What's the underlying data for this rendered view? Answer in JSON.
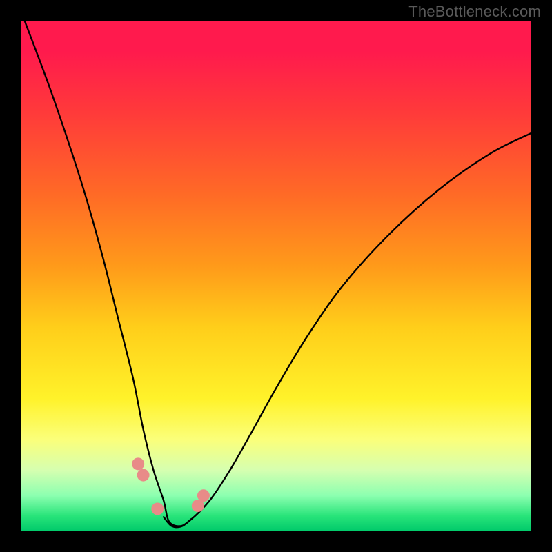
{
  "watermark": "TheBottleneck.com",
  "colors": {
    "background": "#000000",
    "curve": "#000000",
    "marker": "#e88b88",
    "gradient_top": "#ff1a4d",
    "gradient_bottom": "#00c96a"
  },
  "chart_data": {
    "type": "line",
    "title": "",
    "xlabel": "",
    "ylabel": "",
    "xlim": [
      0,
      1
    ],
    "ylim": [
      0,
      1
    ],
    "annotations": [
      "TheBottleneck.com"
    ],
    "series": [
      {
        "name": "bottleneck-curve",
        "x": [
          0.0,
          0.06,
          0.12,
          0.16,
          0.19,
          0.22,
          0.24,
          0.26,
          0.28,
          0.29,
          0.31,
          0.33,
          0.37,
          0.41,
          0.45,
          0.5,
          0.56,
          0.63,
          0.72,
          0.82,
          0.92,
          1.0
        ],
        "y": [
          1.02,
          0.86,
          0.68,
          0.54,
          0.42,
          0.3,
          0.2,
          0.12,
          0.06,
          0.02,
          0.01,
          0.02,
          0.06,
          0.12,
          0.19,
          0.28,
          0.38,
          0.48,
          0.58,
          0.67,
          0.74,
          0.78
        ]
      }
    ],
    "markers": [
      {
        "x": 0.23,
        "y": 0.132
      },
      {
        "x": 0.24,
        "y": 0.11
      },
      {
        "x": 0.268,
        "y": 0.044
      },
      {
        "x": 0.347,
        "y": 0.05
      },
      {
        "x": 0.358,
        "y": 0.07
      }
    ],
    "worm_path": [
      {
        "x": 0.28,
        "y": 0.028
      },
      {
        "x": 0.296,
        "y": 0.01
      },
      {
        "x": 0.316,
        "y": 0.01
      },
      {
        "x": 0.334,
        "y": 0.024
      }
    ]
  }
}
